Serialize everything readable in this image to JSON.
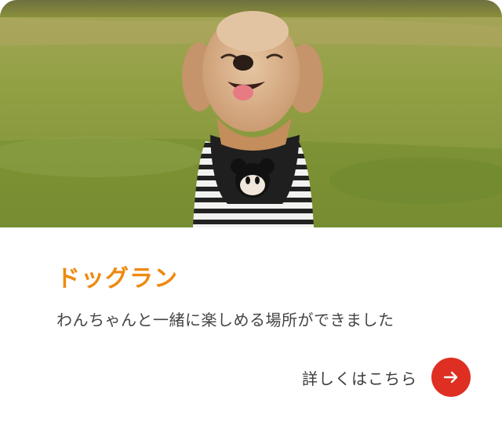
{
  "card": {
    "image": {
      "description_icon": "dog-photo",
      "colors": {
        "grass": "#8c9a3c",
        "fur": "#d8b08c",
        "shirt_stripe": "#2a2a2a"
      }
    },
    "title": "ドッグラン",
    "description": "わんちゃんと一緒に楽しめる場所ができました",
    "more_label": "詳しくはこちら",
    "arrow_icon": "arrow-right-icon",
    "colors": {
      "title": "#ee8a10",
      "button": "#de2f22",
      "text": "#444444"
    }
  }
}
